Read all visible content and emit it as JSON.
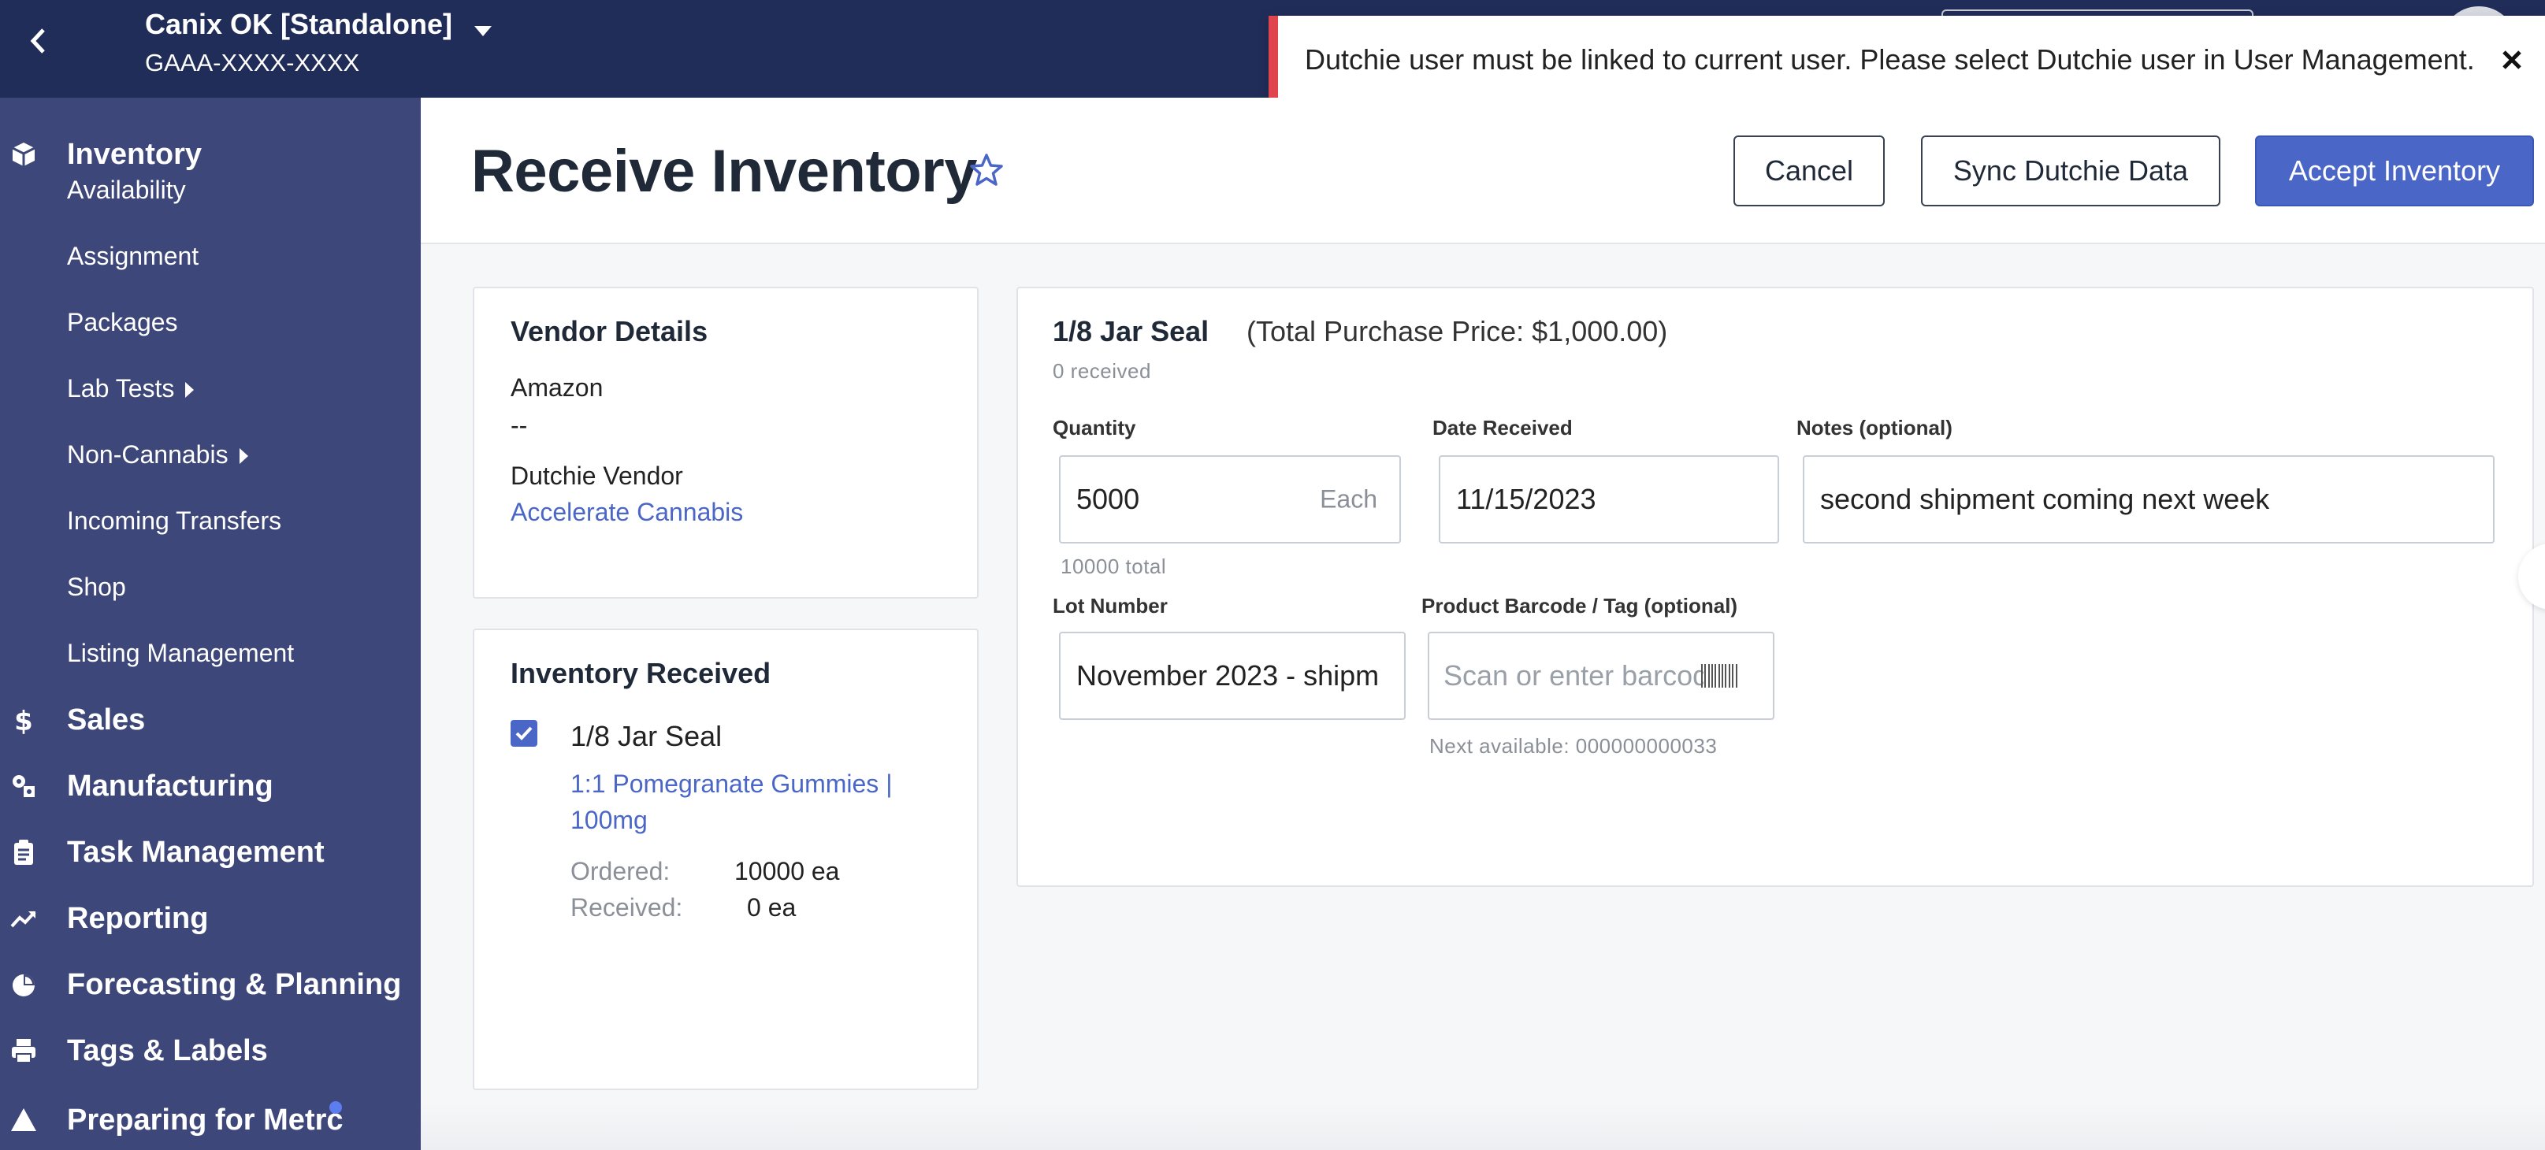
{
  "topbar": {
    "app_title": "Canix OK [Standalone]",
    "app_subtitle": "GAAA-XXXX-XXXX"
  },
  "toast": {
    "message": "Dutchie user must be linked to current user. Please select Dutchie user in User Management."
  },
  "sidebar": {
    "inventory": "Inventory",
    "sub_items": [
      {
        "label": "Availability"
      },
      {
        "label": "Assignment"
      },
      {
        "label": "Packages"
      },
      {
        "label": "Lab Tests"
      },
      {
        "label": "Non-Cannabis"
      },
      {
        "label": "Incoming Transfers"
      },
      {
        "label": "Shop"
      },
      {
        "label": "Listing Management"
      }
    ],
    "sections": [
      {
        "label": "Sales",
        "icon": "dollar-icon"
      },
      {
        "label": "Manufacturing",
        "icon": "manufacturing-icon"
      },
      {
        "label": "Task Management",
        "icon": "clipboard-icon"
      },
      {
        "label": "Reporting",
        "icon": "trend-icon"
      },
      {
        "label": "Forecasting & Planning",
        "icon": "pie-icon"
      },
      {
        "label": "Tags & Labels",
        "icon": "printer-icon"
      },
      {
        "label": "Preparing for Metrc",
        "icon": "warning-icon"
      }
    ]
  },
  "header": {
    "title": "Receive Inventory",
    "cancel": "Cancel",
    "sync": "Sync Dutchie Data",
    "accept": "Accept Inventory"
  },
  "vendor": {
    "heading": "Vendor Details",
    "name": "Amazon",
    "detail": "--",
    "dutchie_label": "Dutchie Vendor",
    "dutchie_link": "Accelerate Cannabis"
  },
  "inventory_received": {
    "heading": "Inventory Received",
    "item_name": "1/8 Jar Seal",
    "item_link": "1:1 Pomegranate Gummies | 100mg",
    "ordered_label": "Ordered:",
    "ordered_value": "10000 ea",
    "received_label": "Received:",
    "received_value": "0 ea",
    "checked": true
  },
  "item_panel": {
    "title": "1/8 Jar Seal",
    "price": "(Total Purchase Price: $1,000.00)",
    "received_count": "0 received",
    "quantity_label": "Quantity",
    "quantity_value": "5000",
    "quantity_unit": "Each",
    "quantity_total": "10000 total",
    "date_label": "Date Received",
    "date_value": "11/15/2023",
    "notes_label": "Notes (optional)",
    "notes_value": "second shipment coming next week",
    "lot_label": "Lot Number",
    "lot_value": "November 2023 - shipm",
    "barcode_label": "Product Barcode / Tag (optional)",
    "barcode_placeholder": "Scan or enter barcode",
    "next_available": "Next available: 000000000033"
  },
  "colors": {
    "topbar": "#212d59",
    "sidebar": "#3e4779",
    "primary": "#4a67c7",
    "toast_accent": "#e0444d"
  }
}
